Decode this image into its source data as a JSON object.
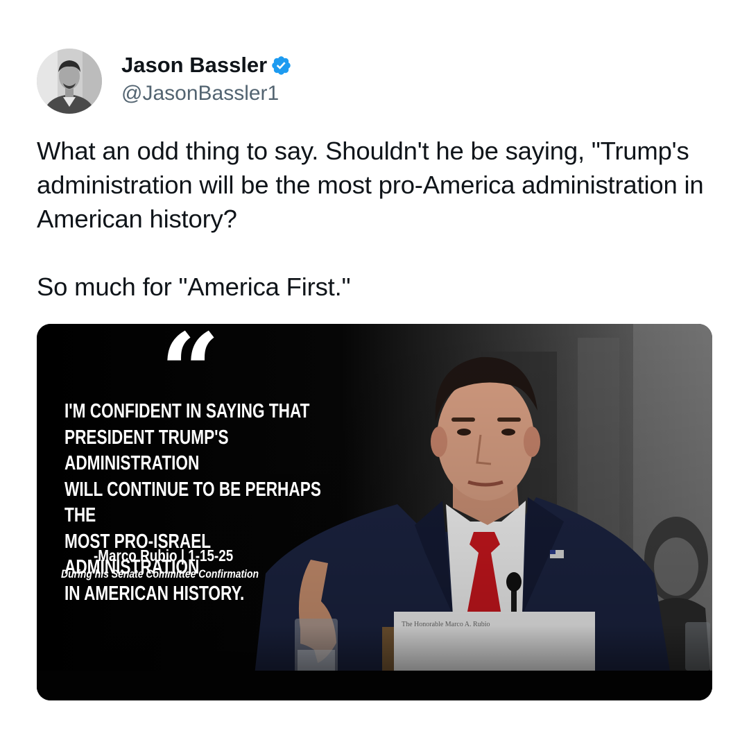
{
  "author": {
    "display_name": "Jason Bassler",
    "handle": "@JasonBassler1",
    "verified": true,
    "verified_color": "#1d9bf0",
    "avatar": "profile-photo-grayscale"
  },
  "tweet": {
    "text": "What an odd thing to say. Shouldn't he be saying, \"Trump's administration will be the most pro-America administration in American history?\n\nSo much for \"America First.\""
  },
  "media": {
    "quote_mark": "“",
    "quote_text": "I'm confident in saying that\nPresident Trump's administration\nwill continue to be perhaps the\nmost pro-Israel administration\nin American history.",
    "attribution": "-Marco Rubio | 1-15-25",
    "attribution_sub": "During his Senate Committee Confirmation",
    "placard_text": "The Honorable Marco A. Rubio"
  },
  "colors": {
    "text_primary": "#0f1419",
    "text_secondary": "#536471",
    "media_background": "#000000",
    "tie": "#c8161d",
    "suit": "#1b2340"
  }
}
